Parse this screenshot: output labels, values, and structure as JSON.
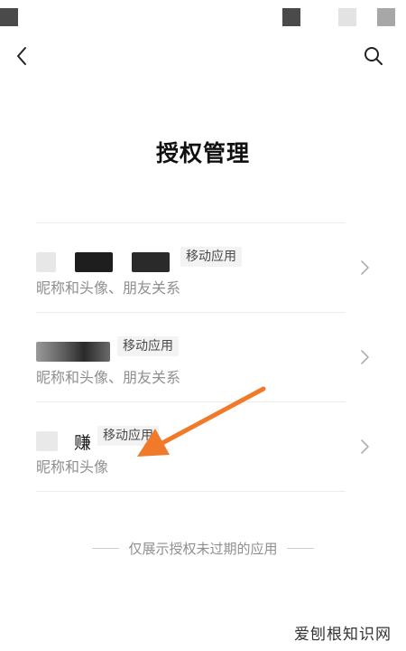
{
  "page": {
    "title": "授权管理",
    "footer_note": "仅展示授权未过期的应用"
  },
  "apps": [
    {
      "name_visible": "",
      "tag": "移动应用",
      "desc": "昵称和头像、朋友关系"
    },
    {
      "name_visible": "",
      "tag": "移动应用",
      "desc": "昵称和头像、朋友关系"
    },
    {
      "name_visible": "赚",
      "tag": "移动应用",
      "desc": "昵称和头像"
    }
  ],
  "icons": {
    "back": "chevron-left-icon",
    "search": "search-icon",
    "row_arrow": "chevron-right-icon"
  },
  "colors": {
    "annotation_arrow": "#f07a2a",
    "divider": "#ececec",
    "secondary_text": "#8f8f8f"
  },
  "watermark": "爱刨根知识网"
}
